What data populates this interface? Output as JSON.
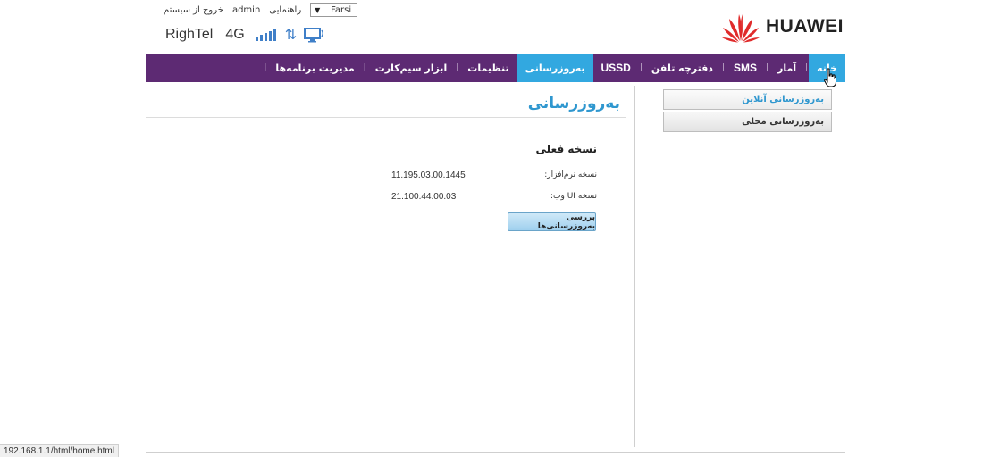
{
  "header": {
    "language": "Farsi",
    "links": {
      "logout": "خروج از سیستم",
      "user": "admin",
      "help": "راهنمایی"
    },
    "carrier": "RighTel",
    "network_type": "4G",
    "logo_text": "HUAWEI"
  },
  "nav": {
    "items": [
      {
        "label": "خانه",
        "active": true
      },
      {
        "label": "آمار"
      },
      {
        "label": "SMS"
      },
      {
        "label": "دفترچه تلفن"
      },
      {
        "label": "USSD"
      },
      {
        "label": "به‌روزرسانی",
        "active": false
      },
      {
        "label": "تنظیمات"
      },
      {
        "label": "ابزار سیم‌کارت"
      },
      {
        "label": "مدیریت برنامه‌ها"
      }
    ]
  },
  "sidebar": {
    "items": [
      {
        "label": "به‌روزرسانی آنلاین",
        "active": true
      },
      {
        "label": "به‌روزرسانی محلی"
      }
    ]
  },
  "content": {
    "title": "به‌روزرسانی",
    "section_title": "نسخه فعلی",
    "rows": [
      {
        "label": "نسخه نرم‌افزار:",
        "value": "11.195.03.00.1445"
      },
      {
        "label": "نسخه UI وب:",
        "value": "21.100.44.00.03"
      }
    ],
    "check_button": "بررسی به‌روزرسانی‌ها"
  },
  "status_bar": {
    "url": "192.168.1.1/html/home.html"
  },
  "colors": {
    "nav_bg": "#5d2a73",
    "accent": "#32a8e0",
    "link_blue": "#2f97cf",
    "huawei_red": "#e02b2b"
  },
  "icons": {
    "signal": "signal-bars-icon",
    "updown": "up-down-arrows-icon",
    "monitor": "monitor-icon",
    "cursor": "hand-pointer-icon"
  }
}
